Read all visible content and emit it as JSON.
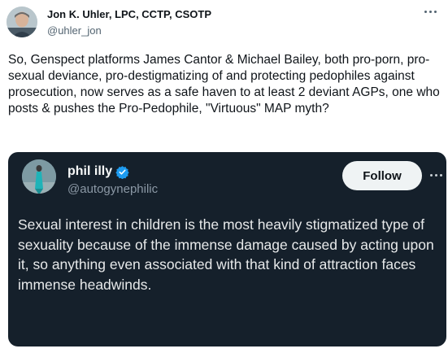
{
  "post": {
    "author_name": "Jon K. Uhler, LPC, CCTP, CSOTP",
    "author_handle": "@uhler_jon",
    "text": "So, Genspect platforms James Cantor & Michael Bailey, both pro-porn, pro-sexual deviance, pro-destigmatizing of and protecting pedophiles against prosecution, now serves as a safe haven to at least 2 deviant AGPs, one who posts & pushes the Pro-Pedophile, \"Virtuous\" MAP myth?",
    "avatar_icon": "profile-photo"
  },
  "quoted_post": {
    "author_name": "phil illy",
    "author_handle": "@autogynephilic",
    "verified_icon": "verified-badge-icon",
    "follow_label": "Follow",
    "text": "Sexual interest in children is the most heavily stigmatized type of sexuality because of the immense damage caused by acting upon it, so anything even associated with that kind of attraction faces immense headwinds.",
    "background_color": "#15202b",
    "accent_color": "#1d9bf0"
  }
}
